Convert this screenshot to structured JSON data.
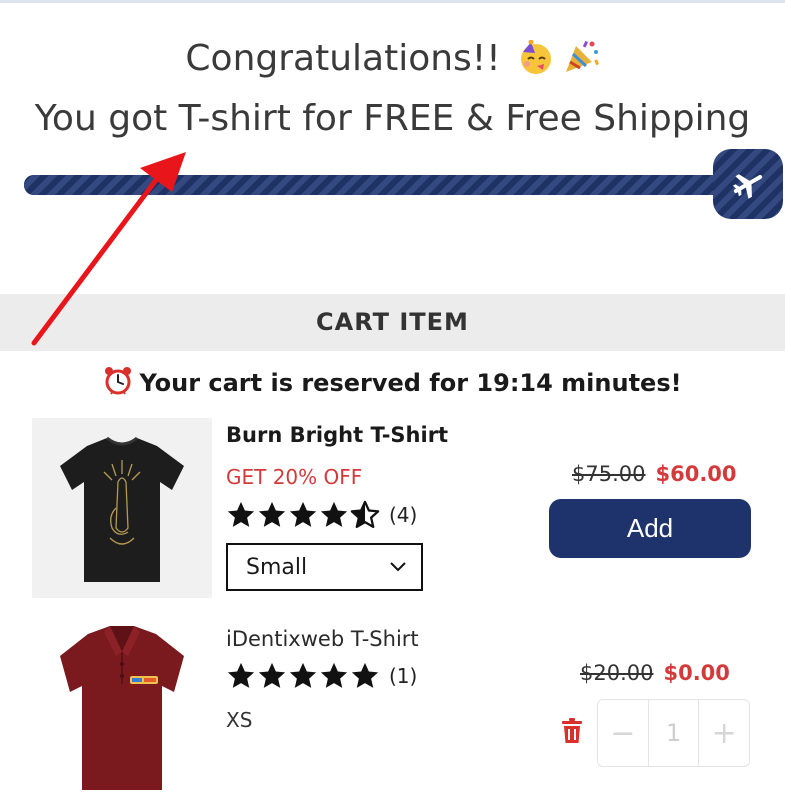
{
  "banner": {
    "line1": "Congratulations!!",
    "line2": "You got T-shirt for FREE & Free Shipping",
    "emoji_icons": [
      "partying-face-icon",
      "party-popper-icon"
    ],
    "progress_fraction": 1.0,
    "badge_icon": "airplane-icon"
  },
  "cart": {
    "header": "CART ITEM",
    "reserved_text": "Your cart is reserved for 19:14 minutes!",
    "reserved_icon": "alarm-clock-icon"
  },
  "items": [
    {
      "title": "Burn Bright T-Shirt",
      "discount": "GET 20% OFF",
      "rating": 4.5,
      "review_count": "(4)",
      "size": "Small",
      "old_price": "$75.00",
      "new_price": "$60.00",
      "add_label": "Add"
    },
    {
      "title": "iDentixweb T-Shirt",
      "rating": 5,
      "review_count": "(1)",
      "variant": "XS",
      "old_price": "$20.00",
      "new_price": "$0.00",
      "quantity": "1",
      "qty_minus": "−",
      "qty_plus": "+"
    }
  ],
  "colors": {
    "accent": "#1e336b",
    "sale": "#d43a3a",
    "arrow": "#e8161b"
  }
}
